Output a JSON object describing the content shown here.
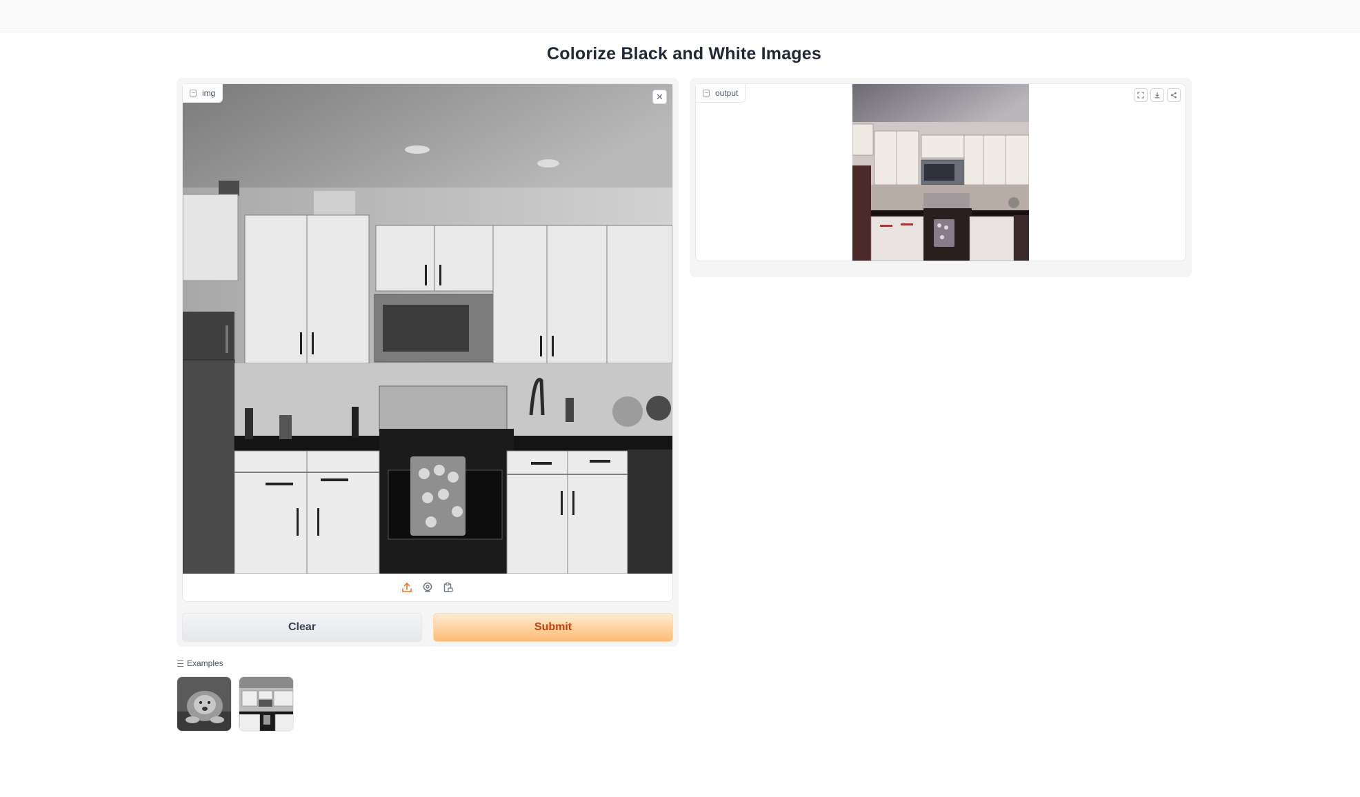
{
  "app": {
    "title": "Colorize Black and White Images"
  },
  "input": {
    "label": "img",
    "image": "grayscale-kitchen-photo",
    "clear_icon": "close-icon",
    "source_icons": [
      "upload-icon",
      "webcam-icon",
      "clipboard-icon"
    ]
  },
  "output": {
    "label": "output",
    "image": "colorized-kitchen-photo",
    "actions": [
      "fullscreen-icon",
      "download-icon",
      "share-icon"
    ]
  },
  "buttons": {
    "clear_label": "Clear",
    "submit_label": "Submit"
  },
  "examples": {
    "label": "Examples",
    "items": [
      {
        "thumbnail": "grayscale-lion"
      },
      {
        "thumbnail": "grayscale-kitchen"
      }
    ]
  },
  "colors": {
    "accent": "#f97316",
    "submit_bg": "#fdba74",
    "submit_text": "#c2410c",
    "panel_bg": "#f5f5f5"
  }
}
